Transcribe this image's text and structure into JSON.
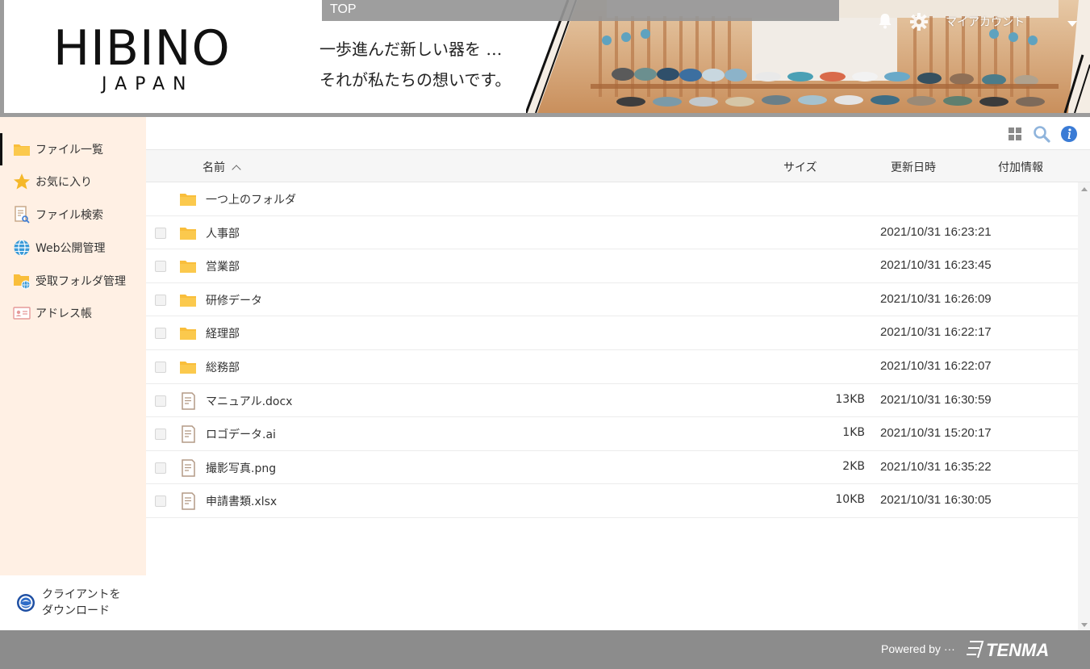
{
  "header": {
    "logo_main": "HIBINO",
    "logo_sub": "JAPAN",
    "tagline_line1": "一歩進んだ新しい器を …",
    "tagline_line2": "それが私たちの想いです。",
    "top_label": "TOP",
    "account_label": "マイアカウント"
  },
  "sidebar": {
    "items": [
      {
        "label": "ファイル一覧",
        "icon": "folder-icon",
        "active": true
      },
      {
        "label": "お気に入り",
        "icon": "star-icon",
        "active": false
      },
      {
        "label": "ファイル検索",
        "icon": "file-search-icon",
        "active": false
      },
      {
        "label": "Web公開管理",
        "icon": "globe-icon",
        "active": false
      },
      {
        "label": "受取フォルダ管理",
        "icon": "folder-globe-icon",
        "active": false
      },
      {
        "label": "アドレス帳",
        "icon": "address-card-icon",
        "active": false
      }
    ],
    "download_line1": "クライアントを",
    "download_line2": "ダウンロード"
  },
  "columns": {
    "name": "名前",
    "size": "サイズ",
    "updated": "更新日時",
    "info": "付加情報"
  },
  "parent_folder": "一つ上のフォルダ",
  "files": [
    {
      "name": "人事部",
      "type": "folder",
      "size": "",
      "date": "2021/10/31 16:23:21"
    },
    {
      "name": "営業部",
      "type": "folder",
      "size": "",
      "date": "2021/10/31 16:23:45"
    },
    {
      "name": "研修データ",
      "type": "folder",
      "size": "",
      "date": "2021/10/31 16:26:09"
    },
    {
      "name": "経理部",
      "type": "folder",
      "size": "",
      "date": "2021/10/31 16:22:17"
    },
    {
      "name": "総務部",
      "type": "folder",
      "size": "",
      "date": "2021/10/31 16:22:07"
    },
    {
      "name": "マニュアル.docx",
      "type": "file",
      "size": "13KB",
      "date": "2021/10/31 16:30:59"
    },
    {
      "name": "ロゴデータ.ai",
      "type": "file",
      "size": "1KB",
      "date": "2021/10/31 15:20:17"
    },
    {
      "name": "撮影写真.png",
      "type": "file",
      "size": "2KB",
      "date": "2021/10/31 16:35:22"
    },
    {
      "name": "申請書類.xlsx",
      "type": "file",
      "size": "10KB",
      "date": "2021/10/31 16:30:05"
    }
  ],
  "footer": {
    "powered": "Powered by ···",
    "brand": "TENMA"
  },
  "colors": {
    "sidebar_bg": "#fff0e4",
    "folder": "#f9be3b",
    "frame_gray": "#9c9c9c",
    "footer_gray": "#8c8c8c",
    "info_blue": "#3a7bd5"
  }
}
